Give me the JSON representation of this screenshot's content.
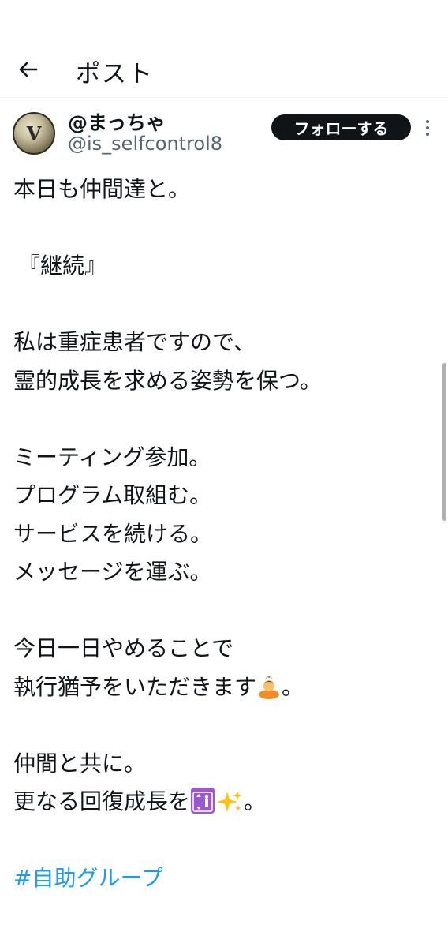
{
  "header": {
    "back_icon": "arrow-left-icon",
    "title": "ポスト"
  },
  "author": {
    "avatar_letter": "V",
    "name": "@まっちゃ",
    "handle": "@is_selfcontrol8",
    "follow_label": "フォローする",
    "more_icon": "more-vertical-icon"
  },
  "post": {
    "lines": [
      "本日も仲間達と。",
      "『継続』",
      "私は重症患者ですので、",
      "霊的成長を求める姿勢を保つ。",
      "ミーティング参加。",
      "プログラム取組む。",
      "サービスを続ける。",
      "メッセージを運ぶ。",
      "今日一日やめることで",
      "執行猶予をいただきます",
      "。",
      "仲間と共に。",
      "更なる回復成長を",
      "。"
    ],
    "emojis": {
      "bow": "person-bowing-emoji",
      "elevator": "elevator-emoji",
      "sparkles": "sparkles-emoji"
    },
    "hashtag": "#自助グループ"
  },
  "colors": {
    "text": "#0f1419",
    "secondary": "#536471",
    "link": "#1d9bf0",
    "follow_bg": "#0f1419"
  }
}
